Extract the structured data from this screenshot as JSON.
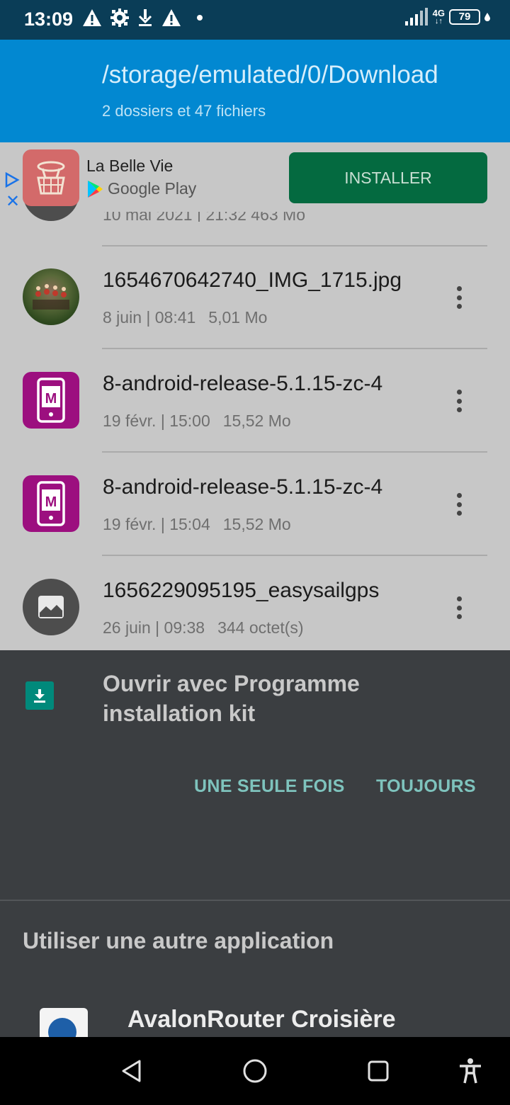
{
  "status_bar": {
    "time": "13:09",
    "network": "4G",
    "battery": "79",
    "icons": [
      "warning-icon",
      "gear-icon",
      "download-icon",
      "warning-icon",
      "dot-icon",
      "signal-icon",
      "battery-icon",
      "drop-icon"
    ]
  },
  "header": {
    "path": "/storage/emulated/0/Download",
    "subtitle": "2 dossiers et 47 fichiers"
  },
  "ad": {
    "app_name": "La Belle Vie",
    "store": "Google Play",
    "install_label": "INSTALLER",
    "install_color": "#046a40"
  },
  "files": {
    "partial_meta": "10 mai 2021 | 21:32   463 Mo",
    "items": [
      {
        "name": "1654670642740_IMG_1715.jpg",
        "date": "8 juin | 08:41",
        "size": "5,01 Mo",
        "thumb": "photo"
      },
      {
        "name": "8-android-release-5.1.15-zc-4",
        "date": "19 févr. | 15:00",
        "size": "15,52 Mo",
        "thumb": "apk-icon"
      },
      {
        "name": "8-android-release-5.1.15-zc-4",
        "date": "19 févr. | 15:04",
        "size": "15,52 Mo",
        "thumb": "apk-icon"
      },
      {
        "name": "1656229095195_easysailgps",
        "date": "26 juin | 09:38",
        "size": "344 octet(s)",
        "thumb": "image-placeholder-icon"
      }
    ]
  },
  "sheet": {
    "title": "Ouvrir avec Programme installation kit",
    "once_label": "UNE SEULE FOIS",
    "always_label": "TOUJOURS",
    "other_label": "Utiliser une autre application",
    "other_app": "AvalonRouter Croisière",
    "accent": "#7ec3bd"
  },
  "nav": {
    "buttons": [
      "back-icon",
      "home-icon",
      "recents-icon",
      "accessibility-icon"
    ]
  }
}
